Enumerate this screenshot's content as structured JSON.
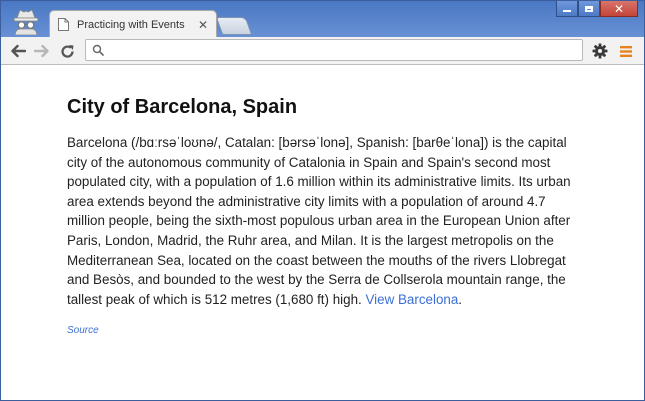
{
  "browser": {
    "tab": {
      "title": "Practicing with Events"
    },
    "omnibox": {
      "value": "",
      "placeholder": ""
    },
    "icons": {
      "incognito": "incognito-icon",
      "favicon": "page-icon",
      "close": "close-icon",
      "back": "back-arrow-icon",
      "forward": "forward-arrow-icon",
      "reload": "reload-icon",
      "search": "search-icon",
      "settings": "gear-icon",
      "menu": "hamburger-menu-icon"
    },
    "colors": {
      "frame": "#4a78c4",
      "menu_accent": "#e8821e",
      "link": "#3b6fd6"
    }
  },
  "article": {
    "title": "City of Barcelona, Spain",
    "body": "Barcelona (/bɑːrsəˈloʊnə/, Catalan: [bərsəˈlonə], Spanish: [barθeˈlona]) is the capital city of the autonomous community of Catalonia in Spain and Spain's second most populated city, with a population of 1.6 million within its administrative limits. Its urban area extends beyond the administrative city limits with a population of around 4.7 million people, being the sixth-most populous urban area in the European Union after Paris, London, Madrid, the Ruhr area, and Milan. It is the largest metropolis on the Mediterranean Sea, located on the coast between the mouths of the rivers Llobregat and Besòs, and bounded to the west by the Serra de Collserola mountain range, the tallest peak of which is 512 metres (1,680 ft) high.",
    "link_label": "View Barcelona",
    "after_link": ".",
    "source_label": "Source"
  }
}
